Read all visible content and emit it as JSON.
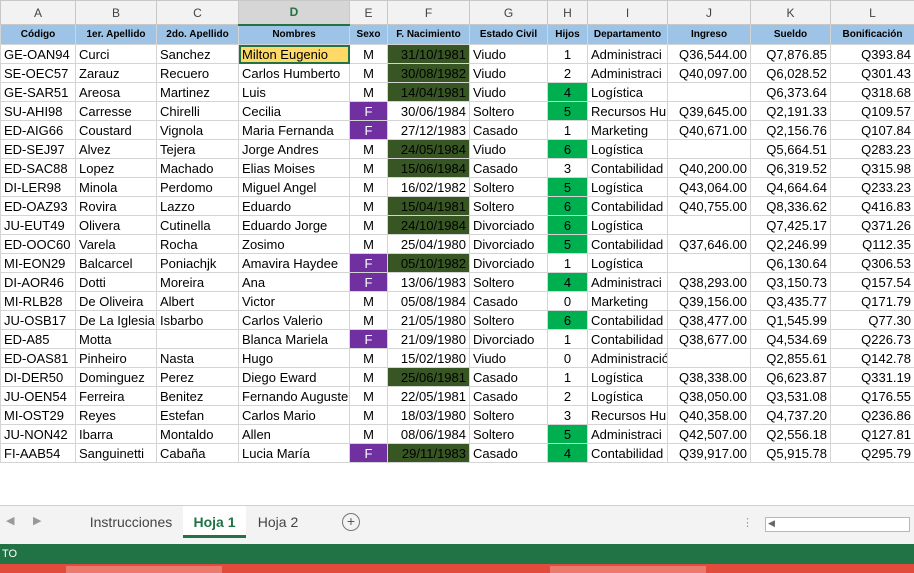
{
  "columns": [
    "A",
    "B",
    "C",
    "D",
    "E",
    "F",
    "G",
    "H",
    "I",
    "J",
    "K",
    "L"
  ],
  "headers": [
    "Código",
    "1er. Apellido",
    "2do. Apellido",
    "Nombres",
    "Sexo",
    "F. Nacimiento",
    "Estado Civil",
    "Hijos",
    "Departamento",
    "Ingreso",
    "Sueldo",
    "Bonificación"
  ],
  "rows": [
    [
      "GE-OAN94",
      "Curci",
      "Sanchez",
      "Milton Eugenio",
      "M",
      "31/10/1981",
      "Viudo",
      "1",
      "Administraci",
      "Q36,544.00",
      "Q7,876.85",
      "Q393.84"
    ],
    [
      "SE-OEC57",
      "Zarauz",
      "Recuero",
      "Carlos Humberto",
      "M",
      "30/08/1982",
      "Viudo",
      "2",
      "Administraci",
      "Q40,097.00",
      "Q6,028.52",
      "Q301.43"
    ],
    [
      "GE-SAR51",
      "Areosa",
      "Martinez",
      "Luis",
      "M",
      "14/04/1981",
      "Viudo",
      "4",
      "Logística",
      "",
      "Q6,373.64",
      "Q318.68"
    ],
    [
      "SU-AHI98",
      "Carresse",
      "Chirelli",
      "Cecilia",
      "F",
      "30/06/1984",
      "Soltero",
      "5",
      "Recursos Hu",
      "Q39,645.00",
      "Q2,191.33",
      "Q109.57"
    ],
    [
      "ED-AIG66",
      "Coustard",
      "Vignola",
      "Maria Fernanda",
      "F",
      "27/12/1983",
      "Casado",
      "1",
      "Marketing",
      "Q40,671.00",
      "Q2,156.76",
      "Q107.84"
    ],
    [
      "ED-SEJ97",
      "Alvez",
      "Tejera",
      "Jorge Andres",
      "M",
      "24/05/1984",
      "Viudo",
      "6",
      "Logística",
      "",
      "Q5,664.51",
      "Q283.23"
    ],
    [
      "ED-SAC88",
      "Lopez",
      "Machado",
      "Elias Moises",
      "M",
      "15/06/1984",
      "Casado",
      "3",
      "Contabilidad",
      "Q40,200.00",
      "Q6,319.52",
      "Q315.98"
    ],
    [
      "DI-LER98",
      "Minola",
      "Perdomo",
      "Miguel Angel",
      "M",
      "16/02/1982",
      "Soltero",
      "5",
      "Logística",
      "Q43,064.00",
      "Q4,664.64",
      "Q233.23"
    ],
    [
      "ED-OAZ93",
      "Rovira",
      "Lazzo",
      "Eduardo",
      "M",
      "15/04/1981",
      "Soltero",
      "6",
      "Contabilidad",
      "Q40,755.00",
      "Q8,336.62",
      "Q416.83"
    ],
    [
      "JU-EUT49",
      "Olivera",
      "Cutinella",
      "Eduardo Jorge",
      "M",
      "24/10/1984",
      "Divorciado",
      "6",
      "Logística",
      "",
      "Q7,425.17",
      "Q371.26"
    ],
    [
      "ED-OOC60",
      "Varela",
      "Rocha",
      "Zosimo",
      "M",
      "25/04/1980",
      "Divorciado",
      "5",
      "Contabilidad",
      "Q37,646.00",
      "Q2,246.99",
      "Q112.35"
    ],
    [
      "MI-EON29",
      "Balcarcel",
      "Poniachjk",
      "Amavira Haydee",
      "F",
      "05/10/1982",
      "Divorciado",
      "1",
      "Logística",
      "",
      "Q6,130.64",
      "Q306.53"
    ],
    [
      "DI-AOR46",
      "Dotti",
      "Moreira",
      "Ana",
      "F",
      "13/06/1983",
      "Soltero",
      "4",
      "Administraci",
      "Q38,293.00",
      "Q3,150.73",
      "Q157.54"
    ],
    [
      "MI-RLB28",
      "De Oliveira",
      "Albert",
      "Victor",
      "M",
      "05/08/1984",
      "Casado",
      "0",
      "Marketing",
      "Q39,156.00",
      "Q3,435.77",
      "Q171.79"
    ],
    [
      "JU-OSB17",
      "De La Iglesia",
      "Isbarbo",
      "Carlos Valerio",
      "M",
      "21/05/1980",
      "Soltero",
      "6",
      "Contabilidad",
      "Q38,477.00",
      "Q1,545.99",
      "Q77.30"
    ],
    [
      "ED-A85",
      "Motta",
      "",
      "Blanca Mariela",
      "F",
      "21/09/1980",
      "Divorciado",
      "1",
      "Contabilidad",
      "Q38,677.00",
      "Q4,534.69",
      "Q226.73"
    ],
    [
      "ED-OAS81",
      "Pinheiro",
      "Nasta",
      "Hugo",
      "M",
      "15/02/1980",
      "Viudo",
      "0",
      "Administración",
      "",
      "Q2,855.61",
      "Q142.78"
    ],
    [
      "DI-DER50",
      "Dominguez",
      "Perez",
      "Diego Eward",
      "M",
      "25/06/1981",
      "Casado",
      "1",
      "Logística",
      "Q38,338.00",
      "Q6,623.87",
      "Q331.19"
    ],
    [
      "JU-OEN54",
      "Ferreira",
      "Benitez",
      "Fernando Auguste",
      "M",
      "22/05/1981",
      "Casado",
      "2",
      "Logística",
      "Q38,050.00",
      "Q3,531.08",
      "Q176.55"
    ],
    [
      "MI-OST29",
      "Reyes",
      "Estefan",
      "Carlos Mario",
      "M",
      "18/03/1980",
      "Soltero",
      "3",
      "Recursos Hu",
      "Q40,358.00",
      "Q4,737.20",
      "Q236.86"
    ],
    [
      "JU-NON42",
      "Ibarra",
      "Montaldo",
      "Allen",
      "M",
      "08/06/1984",
      "Soltero",
      "5",
      "Administraci",
      "Q42,507.00",
      "Q2,556.18",
      "Q127.81"
    ],
    [
      "FI-AAB54",
      "Sanguinetti",
      "Cabaña",
      "Lucia María",
      "F",
      "29/11/1983",
      "Casado",
      "4",
      "Contabilidad",
      "Q39,917.00",
      "Q5,915.78",
      "Q295.79"
    ]
  ],
  "selected_cell": {
    "row": 0,
    "col": 3,
    "column_letter": "D"
  },
  "highlight": {
    "female_color": "#7030a0",
    "dark_date_color": "#375623",
    "green_hijos_color": "#00b050",
    "selected_color": "#ffd966",
    "dark_date_rows": [
      0,
      1,
      2,
      5,
      6,
      8,
      9,
      11,
      17,
      21
    ],
    "green_hijos_rows": [
      2,
      3,
      5,
      7,
      8,
      9,
      10,
      12,
      14,
      20,
      21
    ]
  },
  "sheet_tabs": [
    "Instrucciones",
    "Hoja 1",
    "Hoja 2"
  ],
  "active_tab": "Hoja 1",
  "status_text": "TO"
}
